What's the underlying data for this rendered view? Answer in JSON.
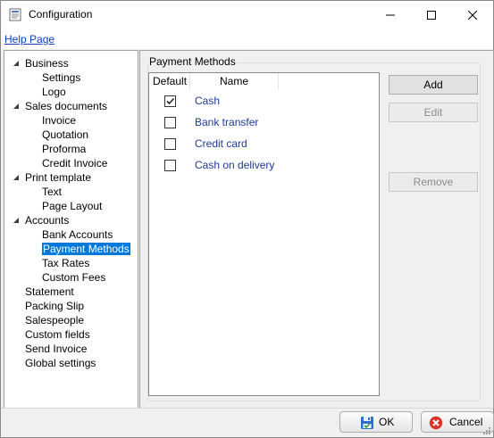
{
  "window": {
    "title": "Configuration"
  },
  "menu": {
    "help_label": "Help Page"
  },
  "tree": [
    {
      "label": "Business",
      "level": 0,
      "expandable": true
    },
    {
      "label": "Settings",
      "level": 1
    },
    {
      "label": "Logo",
      "level": 1
    },
    {
      "label": "Sales documents",
      "level": 0,
      "expandable": true
    },
    {
      "label": "Invoice",
      "level": 1
    },
    {
      "label": "Quotation",
      "level": 1
    },
    {
      "label": "Proforma",
      "level": 1
    },
    {
      "label": "Credit Invoice",
      "level": 1
    },
    {
      "label": "Print template",
      "level": 0,
      "expandable": true
    },
    {
      "label": "Text",
      "level": 1
    },
    {
      "label": "Page Layout",
      "level": 1
    },
    {
      "label": "Accounts",
      "level": 0,
      "expandable": true
    },
    {
      "label": "Bank Accounts",
      "level": 1
    },
    {
      "label": "Payment Methods",
      "level": 1,
      "selected": true
    },
    {
      "label": "Tax Rates",
      "level": 1
    },
    {
      "label": "Custom Fees",
      "level": 1
    },
    {
      "label": "Statement",
      "level": 0
    },
    {
      "label": "Packing Slip",
      "level": 0
    },
    {
      "label": "Salespeople",
      "level": 0
    },
    {
      "label": "Custom fields",
      "level": 0
    },
    {
      "label": "Send Invoice",
      "level": 0
    },
    {
      "label": "Global settings",
      "level": 0
    }
  ],
  "payment_methods": {
    "group_title": "Payment Methods",
    "columns": {
      "default": "Default",
      "name": "Name"
    },
    "rows": [
      {
        "name": "Cash",
        "default": true
      },
      {
        "name": "Bank transfer",
        "default": false
      },
      {
        "name": "Credit card",
        "default": false
      },
      {
        "name": "Cash on delivery",
        "default": false
      }
    ]
  },
  "actions": {
    "add": "Add",
    "edit": "Edit",
    "remove": "Remove"
  },
  "footer": {
    "ok": "OK",
    "cancel": "Cancel"
  },
  "colors": {
    "selection": "#0078d7",
    "link": "#0b3fbf",
    "row_text": "#1f3a93"
  }
}
